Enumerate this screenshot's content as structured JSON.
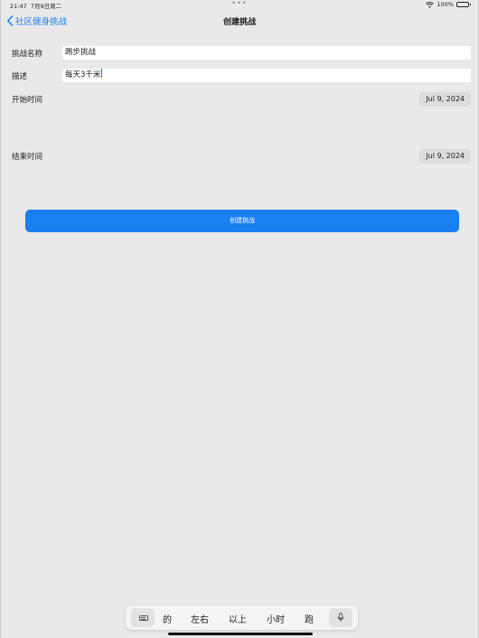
{
  "status_bar": {
    "time": "21:47",
    "date": "7月9日周二",
    "dots": "•••",
    "battery_text": "100%",
    "battery_level": 1.0
  },
  "nav": {
    "back_label": "社区健身挑战",
    "title": "创建挑战"
  },
  "form": {
    "name_label": "挑战名称",
    "name_value": "跑步挑战",
    "description_label": "描述",
    "description_value": "每天3千米",
    "start_label": "开始时间",
    "start_date": "Jul 9, 2024",
    "end_label": "结束时间",
    "end_date": "Jul 9, 2024"
  },
  "create_button_label": "创建挑战",
  "keyboard": {
    "suggestions": [
      "的",
      "左右",
      "以上",
      "小时",
      "跑"
    ]
  },
  "colors": {
    "accent": "#1a7ff0",
    "background": "#e9e9ea"
  }
}
